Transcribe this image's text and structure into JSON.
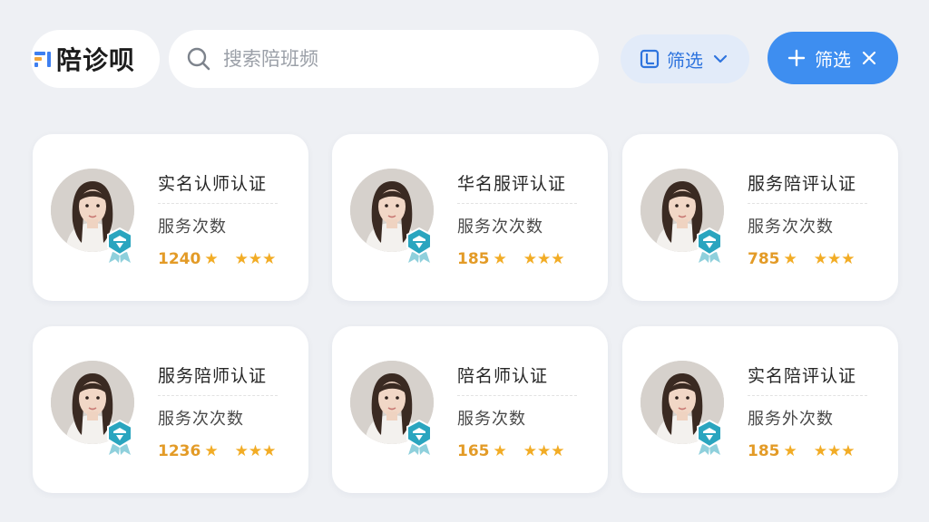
{
  "app": {
    "name": "陪诊呗"
  },
  "search": {
    "placeholder": "搜索陪班频"
  },
  "filters": {
    "secondary_label": "筛选",
    "primary_label": "筛选"
  },
  "colors": {
    "accent": "#3e8ef0",
    "star": "#f2ac25",
    "badge": "#2aa5bf",
    "page_bg": "#eef0f4"
  },
  "cards": [
    {
      "title": "实名认师认证",
      "subtitle": "服务次数",
      "count": "1240",
      "rating": 3
    },
    {
      "title": "华名服评认证",
      "subtitle": "服务次次数",
      "count": "185",
      "rating": 3
    },
    {
      "title": "服务陪评认证",
      "subtitle": "服务次次数",
      "count": "785",
      "rating": 3
    },
    {
      "title": "服务陪师认证",
      "subtitle": "服务次次数",
      "count": "1236",
      "rating": 3
    },
    {
      "title": "陪名师认证",
      "subtitle": "服务次数",
      "count": "165",
      "rating": 3
    },
    {
      "title": "实名陪评认证",
      "subtitle": "服务外次数",
      "count": "185",
      "rating": 3
    }
  ]
}
